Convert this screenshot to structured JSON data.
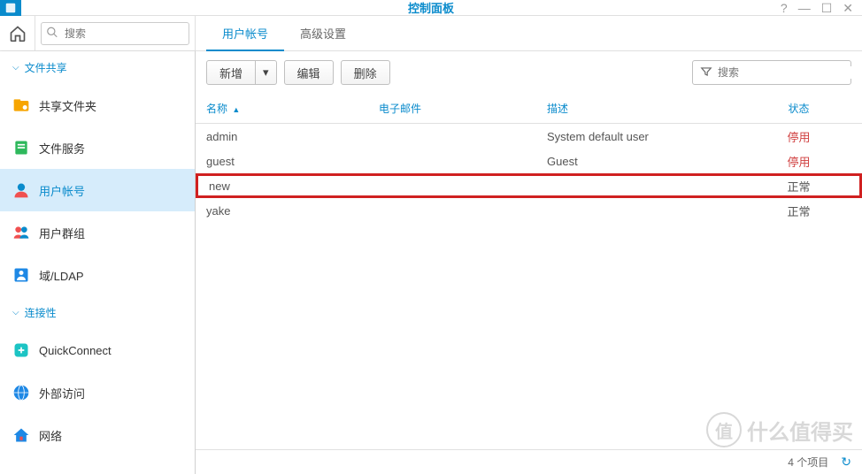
{
  "window": {
    "title": "控制面板"
  },
  "sidebar_search": {
    "placeholder": "搜索"
  },
  "sections": {
    "file_sharing": {
      "label": "文件共享"
    },
    "connectivity": {
      "label": "连接性"
    }
  },
  "nav": {
    "shared_folder": "共享文件夹",
    "file_services": "文件服务",
    "user_account": "用户帐号",
    "user_group": "用户群组",
    "domain_ldap": "域/LDAP",
    "quickconnect": "QuickConnect",
    "external_access": "外部访问",
    "network": "网络"
  },
  "tabs": {
    "user_account": "用户帐号",
    "advanced": "高级设置"
  },
  "actions": {
    "create": "新增",
    "edit": "编辑",
    "delete": "删除"
  },
  "filter": {
    "placeholder": "搜索"
  },
  "columns": {
    "name": "名称",
    "email": "电子邮件",
    "description": "描述",
    "status": "状态"
  },
  "rows": [
    {
      "name": "admin",
      "email": "",
      "description": "System default user",
      "status": "停用",
      "status_class": "disabled"
    },
    {
      "name": "guest",
      "email": "",
      "description": "Guest",
      "status": "停用",
      "status_class": "disabled"
    },
    {
      "name": "new",
      "email": "",
      "description": "",
      "status": "正常",
      "status_class": "normal",
      "highlight": true
    },
    {
      "name": "yake",
      "email": "",
      "description": "",
      "status": "正常",
      "status_class": "normal"
    }
  ],
  "footer": {
    "count_label": "4 个项目"
  },
  "watermark": "什么值得买"
}
